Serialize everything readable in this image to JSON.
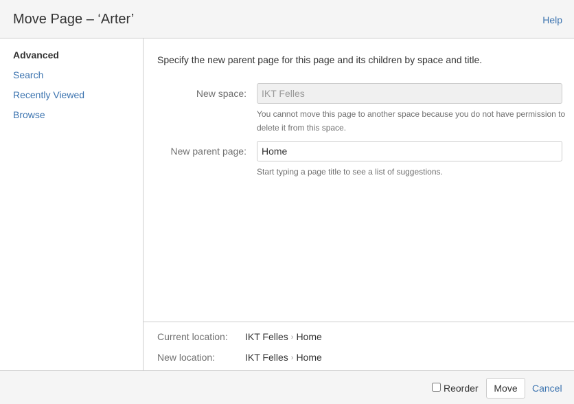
{
  "header": {
    "title": "Move Page – ‘Arter’",
    "help_label": "Help"
  },
  "sidebar": {
    "items": [
      {
        "label": "Advanced",
        "active": true
      },
      {
        "label": "Search",
        "active": false
      },
      {
        "label": "Recently Viewed",
        "active": false
      },
      {
        "label": "Browse",
        "active": false
      }
    ]
  },
  "main": {
    "intro": "Specify the new parent page for this page and its children by space and title.",
    "new_space": {
      "label": "New space:",
      "value": "IKT Felles",
      "description": "You cannot move this page to another space because you do not have permission to delete it from this space."
    },
    "new_parent": {
      "label": "New parent page:",
      "value": "Home",
      "description": "Start typing a page title to see a list of suggestions."
    }
  },
  "locations": {
    "current": {
      "label": "Current location:",
      "space": "IKT Felles",
      "separator": "›",
      "page": "Home"
    },
    "new": {
      "label": "New location:",
      "space": "IKT Felles",
      "separator": "›",
      "page": "Home"
    }
  },
  "footer": {
    "reorder_label": "Reorder",
    "reorder_checked": false,
    "move_label": "Move",
    "cancel_label": "Cancel"
  },
  "colors": {
    "link": "#3b73af",
    "header_bg": "#f5f5f5",
    "border": "#cccccc",
    "muted_text": "#707070"
  }
}
